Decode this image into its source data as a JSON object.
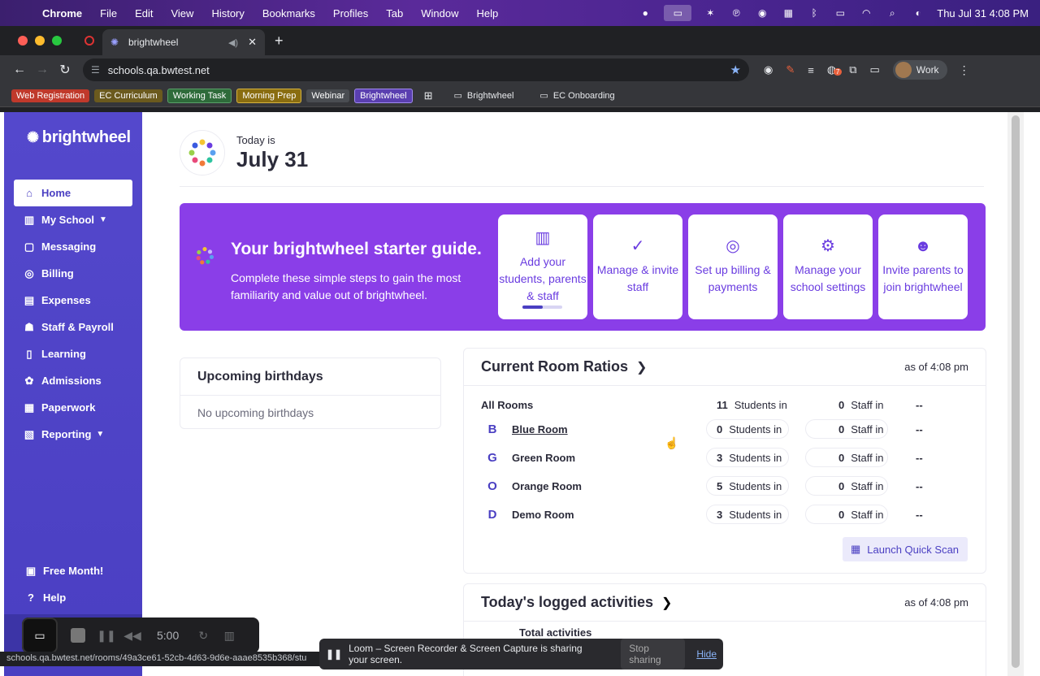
{
  "menubar": {
    "app": "Chrome",
    "items": [
      "File",
      "Edit",
      "View",
      "History",
      "Bookmarks",
      "Profiles",
      "Tab",
      "Window",
      "Help"
    ],
    "clock": "Thu Jul 31  4:08 PM"
  },
  "browser": {
    "tab_title": "brightwheel",
    "url": "schools.qa.bwtest.net",
    "profile": "Work",
    "extension_badge": "7",
    "bookmarks": [
      {
        "label": "Web Registration",
        "color": "#c0392b"
      },
      {
        "label": "EC Curriculum",
        "color": "#6b5a1e"
      },
      {
        "label": "Working Task",
        "color": "#2e6b3a"
      },
      {
        "label": "Morning Prep",
        "color": "#8a6d10"
      },
      {
        "label": "Webinar",
        "color": "#4a4d52"
      },
      {
        "label": "Brightwheel",
        "color": "#5a3fb0"
      }
    ],
    "bookmark_folders": [
      "Brightwheel",
      "EC Onboarding"
    ],
    "status_url": "schools.qa.bwtest.net/rooms/49a3ce61-52cb-4d63-9d6e-aaae8535b368/stu"
  },
  "sidebar": {
    "brand": "brightwheel",
    "items": [
      {
        "label": "Home",
        "icon": "home-icon"
      },
      {
        "label": "My School",
        "icon": "school-icon"
      },
      {
        "label": "Messaging",
        "icon": "chat-icon"
      },
      {
        "label": "Billing",
        "icon": "billing-icon"
      },
      {
        "label": "Expenses",
        "icon": "expenses-icon"
      },
      {
        "label": "Staff & Payroll",
        "icon": "staff-icon"
      },
      {
        "label": "Learning",
        "icon": "book-icon"
      },
      {
        "label": "Admissions",
        "icon": "admissions-icon"
      },
      {
        "label": "Paperwork",
        "icon": "paperwork-icon"
      },
      {
        "label": "Reporting",
        "icon": "chart-icon"
      }
    ],
    "bottom": [
      {
        "label": "Free Month!",
        "icon": "gift-icon"
      },
      {
        "label": "Help",
        "icon": "help-icon"
      }
    ]
  },
  "header": {
    "today_label": "Today is",
    "date": "July 31"
  },
  "guide": {
    "title": "Your brightwheel starter guide.",
    "description": "Complete these simple steps to gain the most familiarity and value out of brightwheel.",
    "cards": [
      {
        "label": "Add your students, parents & staff",
        "icon": "building-icon",
        "progress": 0.5
      },
      {
        "label": "Manage & invite staff",
        "icon": "check-circle-icon"
      },
      {
        "label": "Set up billing & payments",
        "icon": "coins-icon"
      },
      {
        "label": "Manage your school settings",
        "icon": "gear-icon"
      },
      {
        "label": "Invite parents to join brightwheel",
        "icon": "people-icon"
      }
    ]
  },
  "birthdays": {
    "title": "Upcoming birthdays",
    "empty": "No upcoming birthdays"
  },
  "ratios": {
    "title": "Current Room Ratios",
    "as_of": "as of 4:08 pm",
    "students_label": "Students in",
    "staff_label": "Staff in",
    "all_rooms": {
      "name": "All Rooms",
      "students": "11",
      "staff": "0",
      "ratio": "--"
    },
    "rooms": [
      {
        "letter": "B",
        "name": "Blue Room",
        "students": "0",
        "staff": "0",
        "ratio": "--"
      },
      {
        "letter": "G",
        "name": "Green Room",
        "students": "3",
        "staff": "0",
        "ratio": "--"
      },
      {
        "letter": "O",
        "name": "Orange Room",
        "students": "5",
        "staff": "0",
        "ratio": "--"
      },
      {
        "letter": "D",
        "name": "Demo Room",
        "students": "3",
        "staff": "0",
        "ratio": "--"
      }
    ],
    "quick_scan": "Launch Quick Scan"
  },
  "activities": {
    "title": "Today's logged activities",
    "as_of": "as of 4:08 pm",
    "sub": "Total activities"
  },
  "loom": {
    "timer": "5:00",
    "sharing_text": "Loom – Screen Recorder & Screen Capture is sharing your screen.",
    "stop": "Stop sharing",
    "hide": "Hide"
  }
}
